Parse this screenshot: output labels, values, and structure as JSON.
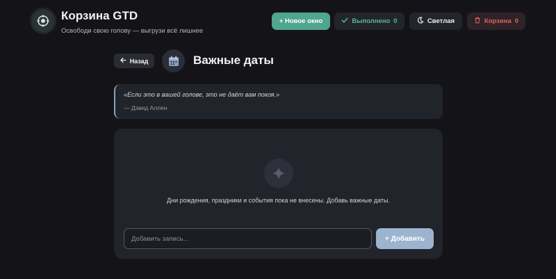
{
  "app": {
    "title": "Корзина GTD",
    "subtitle": "Освободи свою голову — выгрузи всё лишнее",
    "logo_icon": "target-icon"
  },
  "header_actions": {
    "new_window": "+ Новое окно",
    "done_label": "Выполнено",
    "done_count": "0",
    "theme_label": "Светлая",
    "trash_label": "Корзина",
    "trash_count": "0"
  },
  "page": {
    "back_label": "Назад",
    "title": "Важные даты",
    "title_icon": "calendar-icon"
  },
  "quote": {
    "text": "«Если это в вашей голове, это не даёт вам покоя.»",
    "author": "— Дэвид Аллен"
  },
  "list": {
    "empty_icon": "sparkle-icon",
    "empty_text": "Дни рождения, праздники и события пока не внесены. Добавь важные даты.",
    "input_value": "",
    "input_placeholder": "Добавить запись...",
    "add_label": "+ Добавить"
  },
  "colors": {
    "background": "#141418",
    "card": "#22242b",
    "accent_green": "#4fa58f",
    "accent_blue": "#9cb4cf",
    "danger": "#e0605f"
  }
}
